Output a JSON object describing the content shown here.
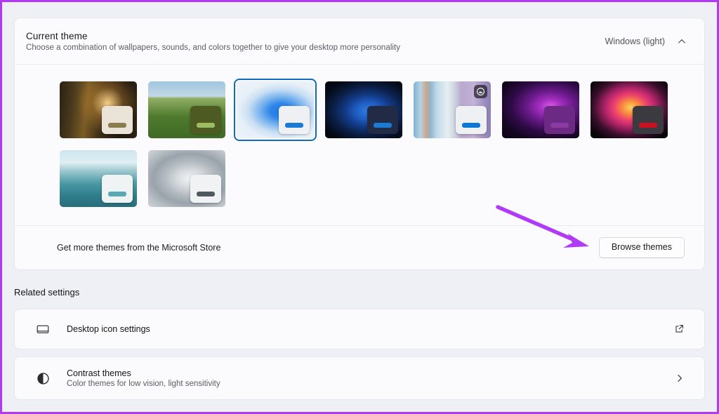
{
  "window": {
    "accent_border_color": "#b13bf5",
    "background_color": "#eef0f5"
  },
  "theme_section": {
    "title": "Current theme",
    "subtitle": "Choose a combination of wallpapers, sounds, and colors together to give your desktop more personality",
    "selected_value": "Windows (light)",
    "collapse_icon": "chevron-up-icon",
    "selection_ring_color": "#0f6cbd",
    "themes": [
      {
        "name": "Sunrise forest theme",
        "wallpaper_class": "wp-forest",
        "card_color": "#eae4d8",
        "accent_color": "#8a7c4e",
        "selected": false,
        "badge": null
      },
      {
        "name": "Castle ruin meadow theme",
        "wallpaper_class": "wp-castle",
        "card_color": "#4d5a21",
        "accent_color": "#9dbc62",
        "selected": false,
        "badge": null
      },
      {
        "name": "Windows light bloom theme",
        "wallpaper_class": "wp-bloom-light",
        "card_color": "#eef0f4",
        "accent_color": "#1a7ad4",
        "selected": true,
        "badge": null
      },
      {
        "name": "Windows dark bloom theme",
        "wallpaper_class": "wp-bloom-dark",
        "card_color": "#222b45",
        "accent_color": "#1a7ad4",
        "selected": false,
        "badge": null
      },
      {
        "name": "Slideshow theme",
        "wallpaper_class": "wp-slideshow",
        "card_color": "#eef0f4",
        "accent_color": "#0a78d4",
        "selected": false,
        "badge": "slideshow-icon"
      },
      {
        "name": "Purple glow theme",
        "wallpaper_class": "wp-purple",
        "card_color": "#6d2a85",
        "accent_color": "#8a3ba3",
        "selected": false,
        "badge": null
      },
      {
        "name": "Flower theme",
        "wallpaper_class": "wp-flower",
        "card_color": "#3a3a40",
        "accent_color": "#cc1020",
        "selected": false,
        "badge": null
      },
      {
        "name": "Lake sunrise theme",
        "wallpaper_class": "wp-lake",
        "card_color": "#f0f3f4",
        "accent_color": "#5aa8b4",
        "selected": false,
        "badge": null
      },
      {
        "name": "Gray bloom theme",
        "wallpaper_class": "wp-gray-bloom",
        "card_color": "#f0f2f3",
        "accent_color": "#4f5a60",
        "selected": false,
        "badge": null
      }
    ],
    "store_row": {
      "label": "Get more themes from the Microsoft Store",
      "button_label": "Browse themes"
    }
  },
  "related_settings": {
    "title": "Related settings",
    "items": [
      {
        "icon": "monitor-icon",
        "title": "Desktop icon settings",
        "subtitle": "",
        "action_icon": "external-link-icon"
      },
      {
        "icon": "contrast-icon",
        "title": "Contrast themes",
        "subtitle": "Color themes for low vision, light sensitivity",
        "action_icon": "chevron-right-icon"
      }
    ]
  },
  "annotation": {
    "type": "arrow",
    "color": "#b13bf5",
    "points_at": "Browse themes"
  }
}
